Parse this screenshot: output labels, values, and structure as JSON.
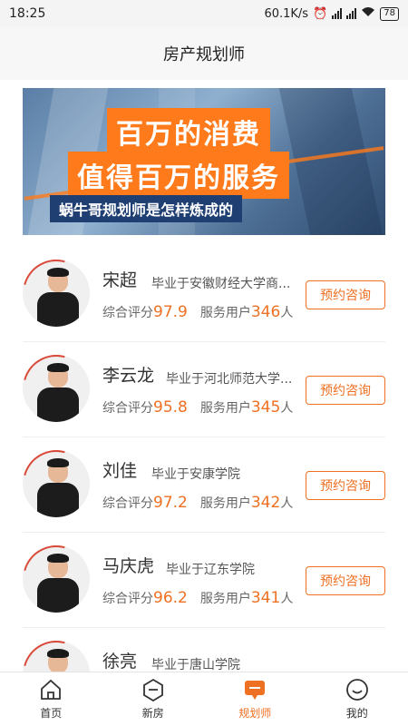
{
  "status": {
    "time": "18:25",
    "speed": "60.1K/s",
    "battery": "78"
  },
  "header": {
    "title": "房产规划师"
  },
  "banner": {
    "line1": "百万的消费",
    "line2": "值得百万的服务",
    "line3": "蜗牛哥规划师是怎样炼成的"
  },
  "labels": {
    "score": "综合评分",
    "users": "服务用户",
    "users_unit": "人",
    "book": "预约咨询"
  },
  "planners": [
    {
      "name": "宋超",
      "school": "毕业于安徽财经大学商...",
      "score": "97.9",
      "users": "346",
      "has_button": true
    },
    {
      "name": "李云龙",
      "school": "毕业于河北师范大学...",
      "score": "95.8",
      "users": "345",
      "has_button": true
    },
    {
      "name": "刘佳",
      "school": "毕业于安康学院",
      "score": "97.2",
      "users": "342",
      "has_button": true
    },
    {
      "name": "马庆虎",
      "school": "毕业于辽东学院",
      "score": "96.2",
      "users": "341",
      "has_button": true
    },
    {
      "name": "徐亮",
      "school": "毕业于唐山学院",
      "score": "",
      "users": "",
      "has_button": false
    }
  ],
  "tabs": [
    {
      "label": "首页",
      "icon": "home-icon",
      "active": false
    },
    {
      "label": "新房",
      "icon": "new-house-icon",
      "active": false
    },
    {
      "label": "规划师",
      "icon": "planner-chat-icon",
      "active": true
    },
    {
      "label": "我的",
      "icon": "profile-smile-icon",
      "active": false
    }
  ],
  "colors": {
    "accent": "#ee7022",
    "banner_orange": "#ff7a1a",
    "banner_navy": "#1f3f73"
  }
}
